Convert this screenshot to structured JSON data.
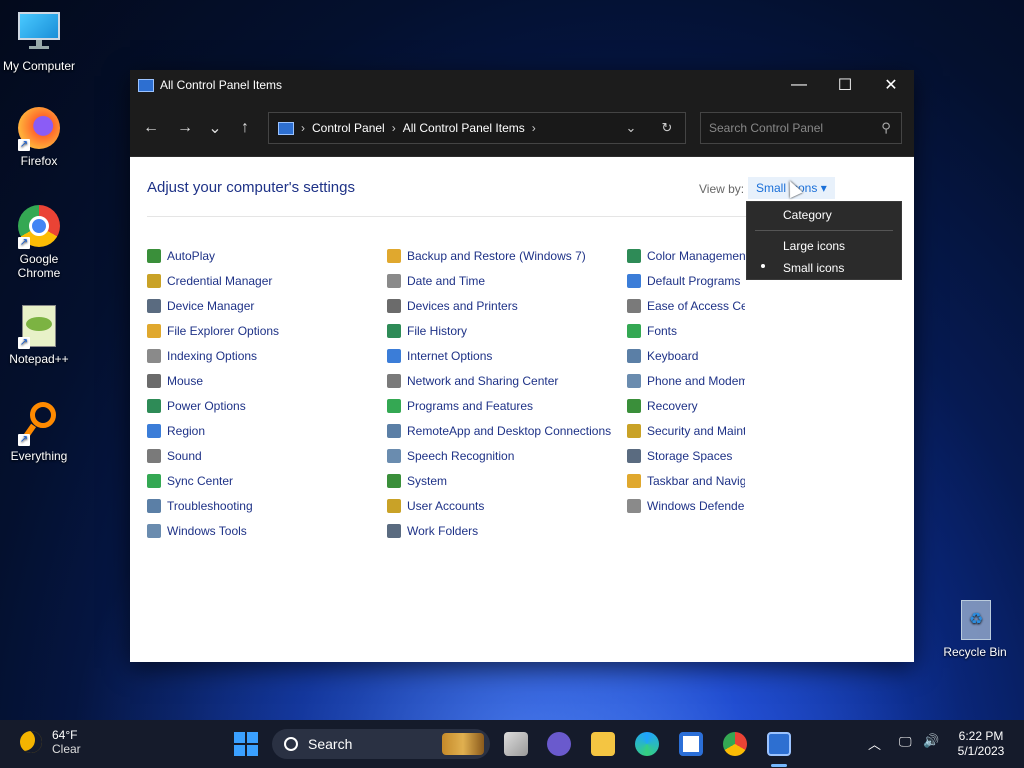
{
  "desktop": {
    "icons": [
      {
        "label": "My Computer"
      },
      {
        "label": "Firefox"
      },
      {
        "label": "Google Chrome"
      },
      {
        "label": "Notepad++"
      },
      {
        "label": "Everything"
      },
      {
        "label": "Recycle Bin"
      }
    ]
  },
  "window": {
    "title": "All Control Panel Items",
    "minimize": "—",
    "maximize": "☐",
    "close": "✕"
  },
  "nav": {
    "back": "←",
    "forward": "→",
    "recent": "⌄",
    "up": "↑",
    "breadcrumb": [
      "Control Panel",
      "All Control Panel Items"
    ],
    "sep": "›",
    "dropdown": "⌄",
    "refresh": "↻",
    "search_placeholder": "Search Control Panel"
  },
  "content": {
    "heading": "Adjust your computer's settings",
    "view_by_label": "View by:",
    "view_by_value": "Small icons ▾",
    "columns": [
      [
        "AutoPlay",
        "Credential Manager",
        "Device Manager",
        "File Explorer Options",
        "Indexing Options",
        "Mouse",
        "Power Options",
        "Region",
        "Sound",
        "Sync Center",
        "Troubleshooting",
        "Windows Tools"
      ],
      [
        "Backup and Restore (Windows 7)",
        "Date and Time",
        "Devices and Printers",
        "File History",
        "Internet Options",
        "Network and Sharing Center",
        "Programs and Features",
        "RemoteApp and Desktop Connections",
        "Speech Recognition",
        "System",
        "User Accounts",
        "Work Folders"
      ],
      [
        "Color Management",
        "Default Programs",
        "Ease of Access Center",
        "Fonts",
        "Keyboard",
        "Phone and Modem",
        "Recovery",
        "Security and Maintenance",
        "Storage Spaces",
        "Taskbar and Navigation",
        "Windows Defender Firewall"
      ]
    ]
  },
  "view_menu": {
    "items": [
      "Category",
      "Large icons",
      "Small icons"
    ],
    "selected": "Small icons"
  },
  "taskbar": {
    "weather_temp": "64°F",
    "weather_desc": "Clear",
    "search_label": "Search",
    "time": "6:22 PM",
    "date": "5/1/2023"
  },
  "colors": {
    "link": "#1e3287",
    "accent": "#1a6fd8",
    "titlebar": "#1c1c1c"
  }
}
